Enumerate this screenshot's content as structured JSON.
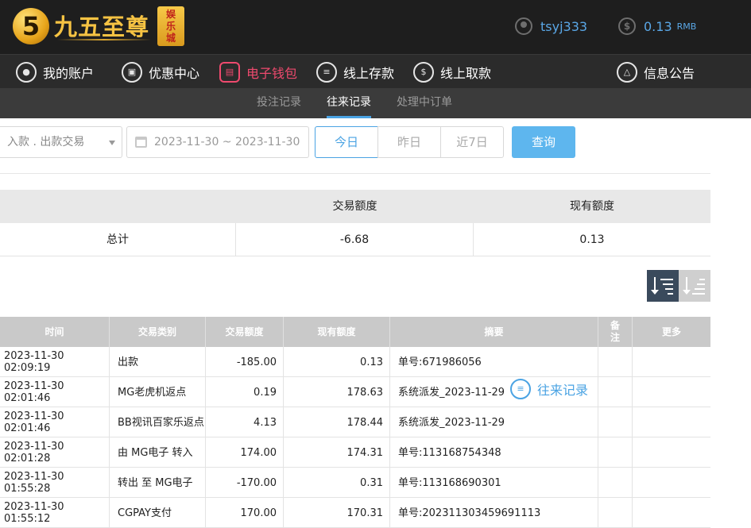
{
  "header": {
    "logo_digit": "5",
    "logo_text": "九五至尊",
    "logo_badge": "娱乐城",
    "username": "tsyj333",
    "balance": "0.13",
    "currency": "RMB",
    "coin_symbol": "$"
  },
  "nav": {
    "items": [
      {
        "label": "我的账户",
        "icon": "user-icon"
      },
      {
        "label": "优惠中心",
        "icon": "gift-icon"
      },
      {
        "label": "电子钱包",
        "icon": "wallet-icon"
      },
      {
        "label": "线上存款",
        "icon": "deposit-icon"
      },
      {
        "label": "线上取款",
        "icon": "withdraw-icon"
      },
      {
        "label": "往来记录",
        "icon": "records-icon"
      },
      {
        "label": "信息公告",
        "icon": "bell-icon"
      }
    ],
    "active": "电子钱包"
  },
  "subnav": {
    "items": [
      "投注记录",
      "往来记录",
      "处理中订单"
    ],
    "active": "往来记录"
  },
  "filter": {
    "type_value": "入款 . 出款交易",
    "date_range": "2023-11-30 ~ 2023-11-30",
    "quick": [
      "今日",
      "昨日",
      "近7日"
    ],
    "active_quick": "今日",
    "query_label": "查询"
  },
  "summary": {
    "headers": [
      "",
      "交易额度",
      "现有额度"
    ],
    "row": {
      "label": "总计",
      "amount": "-6.68",
      "current": "0.13"
    }
  },
  "records": {
    "headers": [
      "时间",
      "交易类别",
      "交易额度",
      "现有额度",
      "摘要",
      "备注",
      "更多"
    ],
    "rows": [
      {
        "time": "2023-11-30 02:09:19",
        "type": "出款",
        "amount": "-185.00",
        "current": "0.13",
        "summary": "单号:671986056"
      },
      {
        "time": "2023-11-30 02:01:46",
        "type": "MG老虎机返点",
        "amount": "0.19",
        "current": "178.63",
        "summary": "系统派发_2023-11-29"
      },
      {
        "time": "2023-11-30 02:01:46",
        "type": "BB视讯百家乐返点",
        "amount": "4.13",
        "current": "178.44",
        "summary": "系统派发_2023-11-29"
      },
      {
        "time": "2023-11-30 02:01:28",
        "type": "由 MG电子 转入",
        "amount": "174.00",
        "current": "174.31",
        "summary": "单号:113168754348"
      },
      {
        "time": "2023-11-30 01:55:28",
        "type": "转出 至 MG电子",
        "amount": "-170.00",
        "current": "0.31",
        "summary": "单号:113168690301"
      },
      {
        "time": "2023-11-30 01:55:12",
        "type": "CGPAY支付",
        "amount": "170.00",
        "current": "170.31",
        "summary": "单号:202311303459691113"
      }
    ]
  }
}
